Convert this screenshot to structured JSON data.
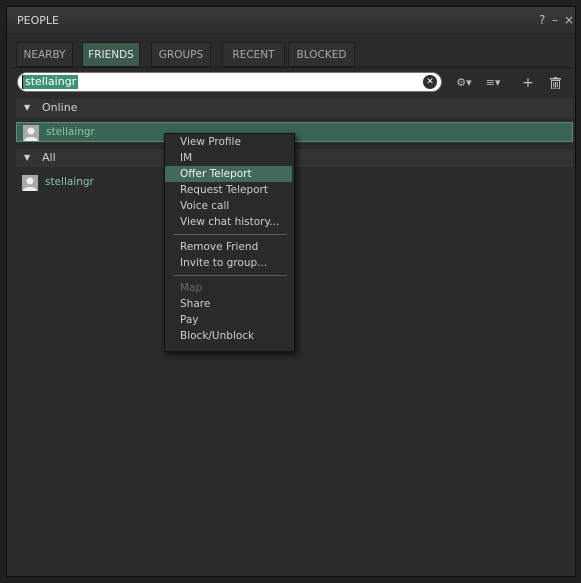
{
  "window": {
    "title": "PEOPLE",
    "help": "?",
    "minimize": "–",
    "close": "×"
  },
  "tabs": [
    {
      "label": "NEARBY",
      "active": false
    },
    {
      "label": "FRIENDS",
      "active": true
    },
    {
      "label": "GROUPS",
      "active": false
    },
    {
      "label": "RECENT",
      "active": false
    },
    {
      "label": "BLOCKED",
      "active": false
    }
  ],
  "search": {
    "value": "stellaingr",
    "clear_icon": "clear-circle-icon"
  },
  "toolbar": {
    "gear": "⚙▾",
    "sort": "≡▾",
    "add": "+",
    "trash_icon": "trash-icon"
  },
  "sections": {
    "online": {
      "label": "Online",
      "arrow": "▼",
      "items": [
        {
          "name": "stellaingr"
        }
      ]
    },
    "all": {
      "label": "All",
      "arrow": "▼",
      "items": [
        {
          "name": "stellaingr"
        }
      ]
    }
  },
  "context_menu": {
    "items": [
      {
        "label": "View Profile",
        "state": "normal"
      },
      {
        "label": "IM",
        "state": "normal"
      },
      {
        "label": "Offer Teleport",
        "state": "highlighted"
      },
      {
        "label": "Request Teleport",
        "state": "normal"
      },
      {
        "label": "Voice call",
        "state": "normal"
      },
      {
        "label": "View chat history...",
        "state": "normal"
      },
      {
        "label": "Remove Friend",
        "state": "normal"
      },
      {
        "label": "Invite to group...",
        "state": "normal"
      },
      {
        "label": "Map",
        "state": "disabled"
      },
      {
        "label": "Share",
        "state": "normal"
      },
      {
        "label": "Pay",
        "state": "normal"
      },
      {
        "label": "Block/Unblock",
        "state": "normal"
      }
    ]
  },
  "colors": {
    "accent": "#3c5b4d",
    "selection": "#3a6453",
    "name_text": "#86c7a4"
  }
}
